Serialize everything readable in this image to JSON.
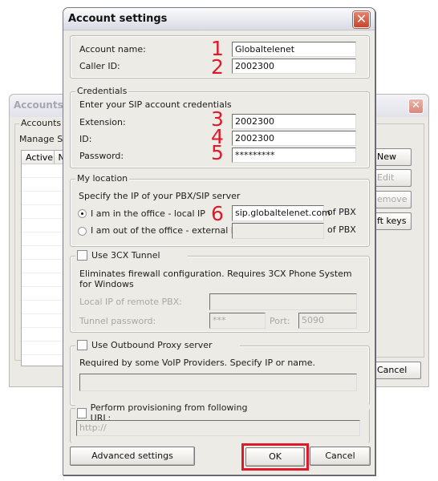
{
  "background_window": {
    "title": "Accounts",
    "group_label": "Accounts",
    "manage_text": "Manage SIP",
    "list_columns": [
      "Active",
      "N"
    ],
    "buttons": [
      {
        "label": "New",
        "enabled": true
      },
      {
        "label": "Edit",
        "enabled": false
      },
      {
        "label": "emove",
        "enabled": false
      },
      {
        "label": "ft keys",
        "enabled": true
      }
    ],
    "cancel_label": "Cancel"
  },
  "dialog": {
    "title": "Account settings",
    "account": {
      "name_label": "Account name:",
      "name_value": "Globaltelenet",
      "callerid_label": "Caller ID:",
      "callerid_value": "2002300"
    },
    "credentials": {
      "legend": "Credentials",
      "hint": "Enter your SIP account credentials",
      "extension_label": "Extension:",
      "extension_value": "2002300",
      "id_label": "ID:",
      "id_value": "2002300",
      "password_label": "Password:",
      "password_value": "*********"
    },
    "location": {
      "legend": "My location",
      "hint": "Specify the IP of your PBX/SIP server",
      "local_label": "I am in the office - local IP",
      "local_selected": true,
      "local_value": "sip.globaltelenet.com",
      "external_label": "I am out of the office - external IP",
      "external_selected": false,
      "external_value": "",
      "of_pbx": "of PBX"
    },
    "tunnel": {
      "checkbox_label": "Use 3CX Tunnel",
      "checked": false,
      "description": "Eliminates firewall configuration. Requires 3CX Phone System for Windows",
      "remote_ip_label": "Local IP of remote PBX:",
      "remote_ip_value": "",
      "password_label": "Tunnel password:",
      "password_value": "***",
      "port_label": "Port:",
      "port_value": "5090"
    },
    "proxy": {
      "checkbox_label": "Use Outbound Proxy server",
      "checked": false,
      "description": "Required by some VoIP Providers. Specify IP or name.",
      "value": ""
    },
    "provisioning": {
      "checkbox_label": "Perform provisioning from following URL:",
      "checked": false,
      "placeholder": "http://"
    },
    "buttons": {
      "advanced": "Advanced settings",
      "ok": "OK",
      "cancel": "Cancel"
    }
  },
  "annotations": [
    "1",
    "2",
    "3",
    "4",
    "5",
    "6"
  ],
  "colors": {
    "annotation_red": "#e0192a",
    "dialog_bg": "#ecebe5"
  }
}
